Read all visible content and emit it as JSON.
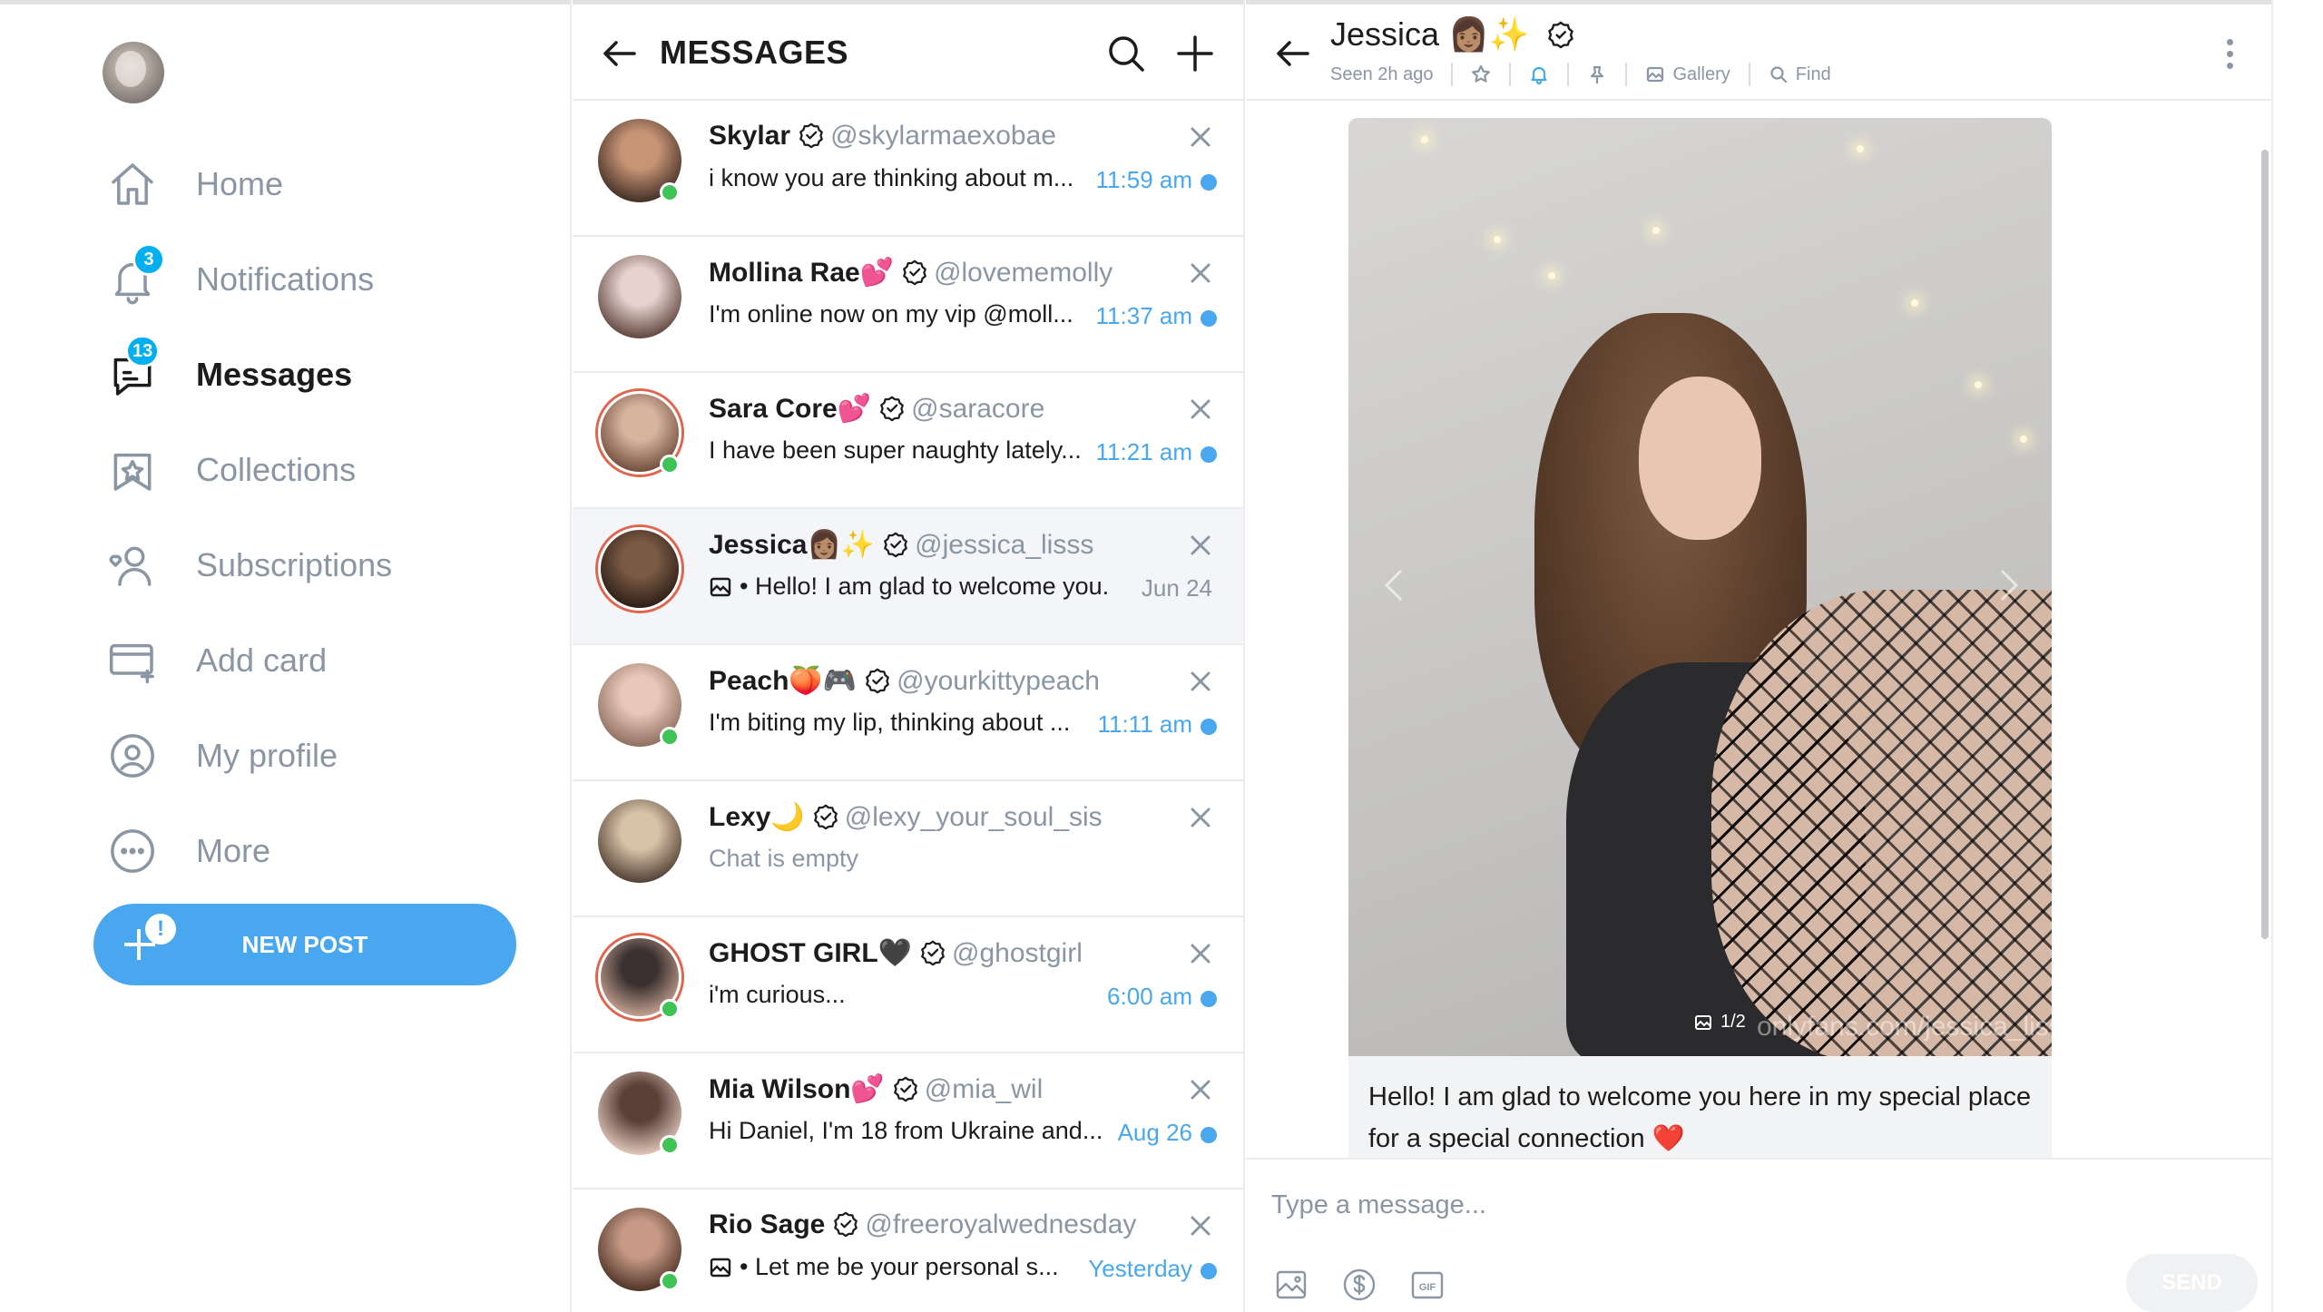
{
  "sidebar": {
    "nav": [
      {
        "label": "Home",
        "icon": "home-icon"
      },
      {
        "label": "Notifications",
        "icon": "bell-icon",
        "badge": "3"
      },
      {
        "label": "Messages",
        "icon": "message-icon",
        "badge": "13",
        "active": true
      },
      {
        "label": "Collections",
        "icon": "bookmark-icon"
      },
      {
        "label": "Subscriptions",
        "icon": "user-icon"
      },
      {
        "label": "Add card",
        "icon": "card-icon"
      },
      {
        "label": "My profile",
        "icon": "profile-icon"
      },
      {
        "label": "More",
        "icon": "more-icon"
      }
    ],
    "new_post_label": "NEW POST",
    "new_post_alert": "!"
  },
  "list": {
    "title": "MESSAGES",
    "chats": [
      {
        "name": "Skylar",
        "emoji": "",
        "handle": "@skylarmaexobae",
        "preview": "i know you are thinking about m...",
        "time": "11:59 am",
        "unread": true,
        "online": true
      },
      {
        "name": "Mollina Rae",
        "emoji": "💕",
        "handle": "@lovememolly",
        "preview": "I'm online now on my vip @moll...",
        "time": "11:37 am",
        "unread": true,
        "online": false
      },
      {
        "name": "Sara Core",
        "emoji": "💕",
        "handle": "@saracore",
        "preview": "I have been super naughty lately...",
        "time": "11:21 am",
        "unread": true,
        "online": true
      },
      {
        "name": "Jessica",
        "emoji": "👩🏽✨",
        "handle": "@jessica_lisss",
        "preview": "• Hello! I am glad to welcome you...",
        "time": "Jun 24",
        "unread": false,
        "online": false,
        "selected": true,
        "has_media": true
      },
      {
        "name": "Peach",
        "emoji": "🍑🎮",
        "handle": "@yourkittypeach",
        "preview": "I'm biting my lip, thinking about ...",
        "time": "11:11 am",
        "unread": true,
        "online": true
      },
      {
        "name": "Lexy",
        "emoji": "🌙",
        "handle": "@lexy_your_soul_sis",
        "preview": "Chat is empty",
        "time": "",
        "unread": false,
        "online": false,
        "muted": true
      },
      {
        "name": "GHOST GIRL",
        "emoji": "🖤",
        "handle": "@ghostgirl",
        "preview": "i'm curious...",
        "time": "6:00 am",
        "unread": true,
        "online": true
      },
      {
        "name": "Mia Wilson",
        "emoji": "💕",
        "handle": "@mia_wil",
        "preview": "Hi Daniel, I'm 18 from Ukraine and...",
        "time": "Aug 26",
        "unread": true,
        "online": true
      },
      {
        "name": "Rio Sage",
        "emoji": "",
        "handle": "@freeroyalwednesday",
        "preview": "• Let me be your personal s...",
        "time": "Yesterday",
        "unread": true,
        "online": true,
        "has_media": true
      }
    ]
  },
  "pane": {
    "name": "Jessica",
    "emoji": "👩🏽✨",
    "seen": "Seen 2h ago",
    "gallery_label": "Gallery",
    "find_label": "Find",
    "photo_counter": "1/2",
    "watermark": "onlyfans.com/jessica_lisss",
    "message": "Hello! I am glad to welcome you here in my special place for a special connection",
    "message_emoji": "❤️",
    "compose_placeholder": "Type a message...",
    "send_label": "SEND"
  },
  "colors": {
    "accent": "#48a7ee",
    "online": "#3fc356",
    "muted": "#8a96a3"
  }
}
